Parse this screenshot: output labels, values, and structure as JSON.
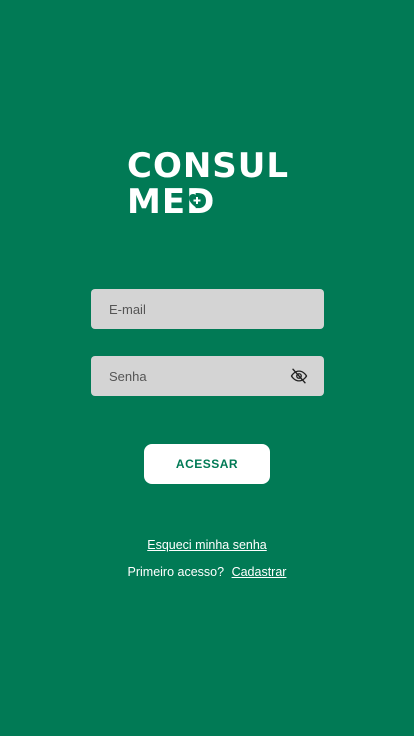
{
  "brand": {
    "line1": "CONSUL",
    "line2_prefix": "ME",
    "line2_suffix": "D"
  },
  "form": {
    "email_placeholder": "E-mail",
    "password_placeholder": "Senha",
    "submit_label": "ACESSAR"
  },
  "links": {
    "forgot_password": "Esqueci minha senha",
    "first_access_text": "Primeiro acesso?",
    "signup": "Cadastrar"
  },
  "icons": {
    "password_toggle": "eye-off-icon",
    "logo_symbol": "heart-plus-icon"
  },
  "colors": {
    "background": "#017A55",
    "input_background": "#D4D4D4",
    "button_background": "#FFFFFF",
    "button_text": "#017A55"
  }
}
